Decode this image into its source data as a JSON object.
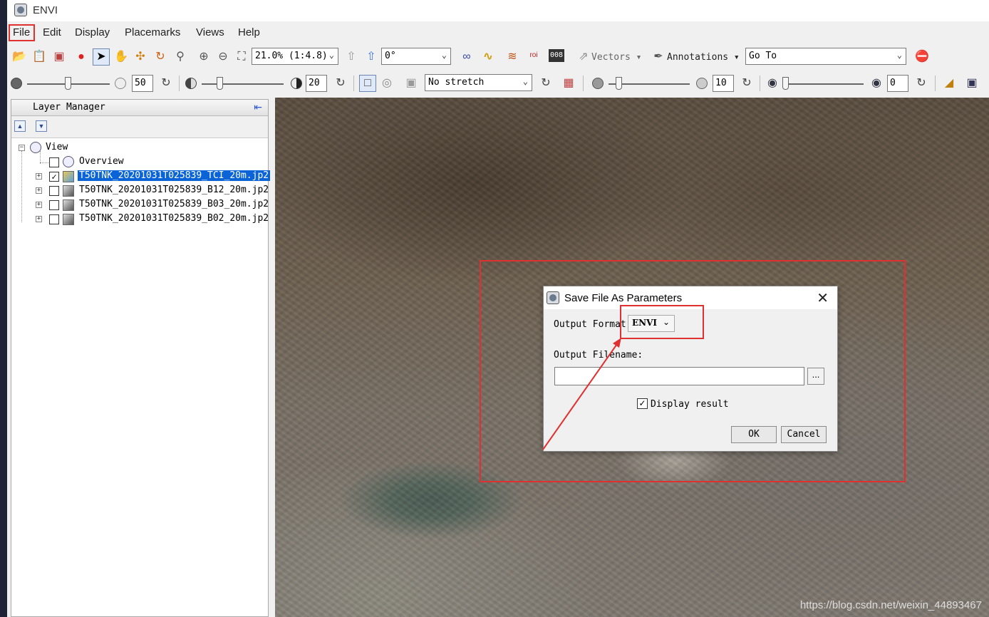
{
  "app": {
    "title": "ENVI"
  },
  "menu": [
    "File",
    "Edit",
    "Display",
    "Placemarks",
    "Views",
    "Help"
  ],
  "toolbar1": {
    "zoom_value": "21.0% (1:4.8)",
    "rotation_value": "0°",
    "vectors_label": "Vectors",
    "annotations_label": "Annotations",
    "goto_label": "Go To",
    "roi_label": "roi",
    "counter_label": "008"
  },
  "toolbar2": {
    "brightness_value": "50",
    "contrast_value": "20",
    "stretch_value": "No stretch",
    "sharpen_value": "10",
    "transparency_value": "0"
  },
  "layer_manager": {
    "title": "Layer Manager",
    "root_label": "View",
    "overview_label": "Overview",
    "layers": [
      {
        "name": "T50TNK_20201031T025839_TCI_20m.jp2",
        "checked": true,
        "selected": true
      },
      {
        "name": "T50TNK_20201031T025839_B12_20m.jp2",
        "checked": false,
        "selected": false
      },
      {
        "name": "T50TNK_20201031T025839_B03_20m.jp2",
        "checked": false,
        "selected": false
      },
      {
        "name": "T50TNK_20201031T025839_B02_20m.jp2",
        "checked": false,
        "selected": false
      }
    ]
  },
  "dialog": {
    "title": "Save File As Parameters",
    "output_format_label": "Output Format",
    "output_format_value": "ENVI",
    "output_filename_label": "Output Filename:",
    "output_filename_value": "",
    "browse_label": "...",
    "display_result_label": "Display result",
    "display_result_checked": true,
    "ok_label": "OK",
    "cancel_label": "Cancel"
  },
  "watermark": "https://blog.csdn.net/weixin_44893467",
  "colors": {
    "highlight": "#e03030",
    "selection": "#0a64d8"
  }
}
